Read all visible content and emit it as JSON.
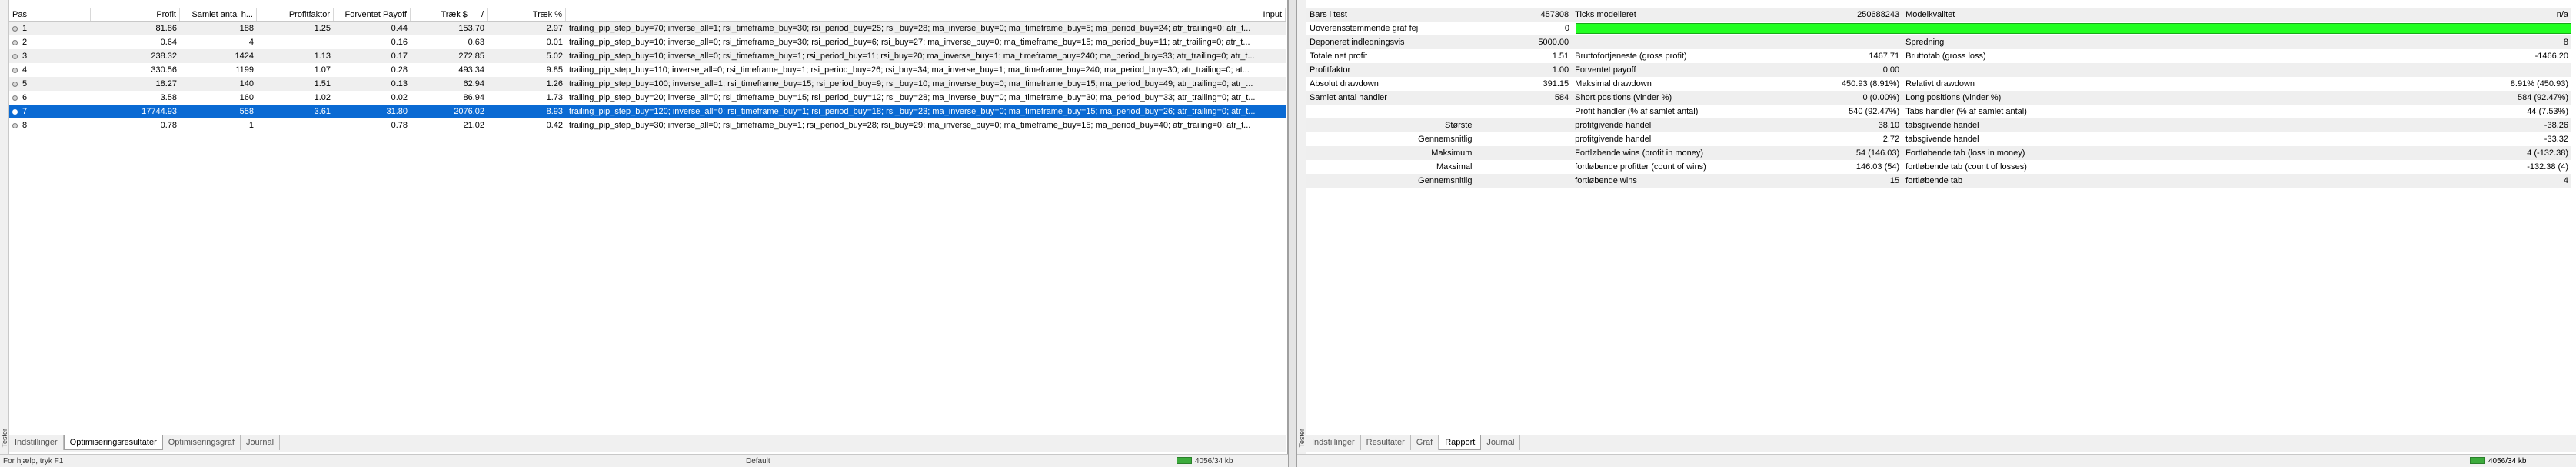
{
  "left": {
    "vertical_tab": "Tester",
    "columns": [
      "Pas",
      "Profit",
      "Samlet antal h...",
      "Profitfaktor",
      "Forventet Payoff",
      "Træk $",
      "/",
      "Træk %",
      "Input"
    ],
    "rows": [
      {
        "pas": "1",
        "profit": "81.86",
        "trades": "188",
        "pf": "1.25",
        "payoff": "0.44",
        "dd": "153.70",
        "ddp": "2.97",
        "input": "trailing_pip_step_buy=70; inverse_all=1; rsi_timeframe_buy=30; rsi_period_buy=25; rsi_buy=28; ma_inverse_buy=0; ma_timeframe_buy=5; ma_period_buy=24; atr_trailing=0; atr_t..."
      },
      {
        "pas": "2",
        "profit": "0.64",
        "trades": "4",
        "pf": "",
        "payoff": "0.16",
        "dd": "0.63",
        "ddp": "0.01",
        "input": "trailing_pip_step_buy=10; inverse_all=0; rsi_timeframe_buy=30; rsi_period_buy=6; rsi_buy=27; ma_inverse_buy=0; ma_timeframe_buy=15; ma_period_buy=11; atr_trailing=0; atr_t..."
      },
      {
        "pas": "3",
        "profit": "238.32",
        "trades": "1424",
        "pf": "1.13",
        "payoff": "0.17",
        "dd": "272.85",
        "ddp": "5.02",
        "input": "trailing_pip_step_buy=10; inverse_all=0; rsi_timeframe_buy=1; rsi_period_buy=11; rsi_buy=20; ma_inverse_buy=1; ma_timeframe_buy=240; ma_period_buy=33; atr_trailing=0; atr_t..."
      },
      {
        "pas": "4",
        "profit": "330.56",
        "trades": "1199",
        "pf": "1.07",
        "payoff": "0.28",
        "dd": "493.34",
        "ddp": "9.85",
        "input": "trailing_pip_step_buy=110; inverse_all=0; rsi_timeframe_buy=1; rsi_period_buy=26; rsi_buy=34; ma_inverse_buy=1; ma_timeframe_buy=240; ma_period_buy=30; atr_trailing=0; at..."
      },
      {
        "pas": "5",
        "profit": "18.27",
        "trades": "140",
        "pf": "1.51",
        "payoff": "0.13",
        "dd": "62.94",
        "ddp": "1.26",
        "input": "trailing_pip_step_buy=100; inverse_all=1; rsi_timeframe_buy=15; rsi_period_buy=9; rsi_buy=10; ma_inverse_buy=0; ma_timeframe_buy=15; ma_period_buy=49; atr_trailing=0; atr_..."
      },
      {
        "pas": "6",
        "profit": "3.58",
        "trades": "160",
        "pf": "1.02",
        "payoff": "0.02",
        "dd": "86.94",
        "ddp": "1.73",
        "input": "trailing_pip_step_buy=20; inverse_all=0; rsi_timeframe_buy=15; rsi_period_buy=12; rsi_buy=28; ma_inverse_buy=0; ma_timeframe_buy=30; ma_period_buy=33; atr_trailing=0; atr_t..."
      },
      {
        "pas": "7",
        "profit": "17744.93",
        "trades": "558",
        "pf": "3.61",
        "payoff": "31.80",
        "dd": "2076.02",
        "ddp": "8.93",
        "input": "trailing_pip_step_buy=120; inverse_all=0; rsi_timeframe_buy=1; rsi_period_buy=18; rsi_buy=23; ma_inverse_buy=0; ma_timeframe_buy=15; ma_period_buy=26; atr_trailing=0; atr_t..."
      },
      {
        "pas": "8",
        "profit": "0.78",
        "trades": "1",
        "pf": "",
        "payoff": "0.78",
        "dd": "21.02",
        "ddp": "0.42",
        "input": "trailing_pip_step_buy=30; inverse_all=0; rsi_timeframe_buy=1; rsi_period_buy=28; rsi_buy=29; ma_inverse_buy=0; ma_timeframe_buy=15; ma_period_buy=40; atr_trailing=0; atr_t..."
      }
    ],
    "selected_row": "7",
    "tabs": [
      "Indstillinger",
      "Optimiseringsresultater",
      "Optimiseringsgraf",
      "Journal"
    ],
    "active_tab": "Optimiseringsresultater",
    "status": {
      "text": "For hjælp, tryk F1",
      "profile": "Default",
      "connection": "4056/34 kb"
    }
  },
  "right": {
    "vertical_tab": "Tester",
    "report": [
      {
        "l1": "Bars i test",
        "v1": "457308",
        "l2": "Ticks modelleret",
        "v2": "250688243",
        "l3": "Modelkvalitet",
        "v3": "n/a"
      },
      {
        "l1": "Uoverensstemmende graf fejl",
        "v1": "0",
        "graph": true
      },
      {
        "l1": "Deponeret indledningsvis",
        "v1": "5000.00",
        "l2": "",
        "v2": "",
        "l3": "Spredning",
        "v3": "8"
      },
      {
        "l1": "Totale net profit",
        "v1": "1.51",
        "l2": "Bruttofortjeneste (gross profit)",
        "v2": "1467.71",
        "l3": "Bruttotab (gross loss)",
        "v3": "-1466.20"
      },
      {
        "l1": "Profitfaktor",
        "v1": "1.00",
        "l2": "Forventet payoff",
        "v2": "0.00",
        "l3": "",
        "v3": ""
      },
      {
        "l1": "Absolut drawdown",
        "v1": "391.15",
        "l2": "Maksimal drawdown",
        "v2": "450.93 (8.91%)",
        "l3": "Relativt drawdown",
        "v3": "8.91% (450.93)"
      },
      {
        "l1": "Samlet antal handler",
        "v1": "584",
        "l2": "Short positions (vinder %)",
        "v2": "0 (0.00%)",
        "l3": "Long positions (vinder %)",
        "v3": "584 (92.47%)"
      },
      {
        "l1": "",
        "v1": "",
        "l2": "Profit handler (% af samlet antal)",
        "v2": "540 (92.47%)",
        "l3": "Tabs handler (% af samlet antal)",
        "v3": "44 (7.53%)"
      },
      {
        "l1": "Største",
        "v1": "",
        "l2": "profitgivende handel",
        "v2": "38.10",
        "l3": "tabsgivende handel",
        "v3": "-38.26",
        "right": true
      },
      {
        "l1": "Gennemsnitlig",
        "v1": "",
        "l2": "profitgivende handel",
        "v2": "2.72",
        "l3": "tabsgivende handel",
        "v3": "-33.32",
        "right": true
      },
      {
        "l1": "Maksimum",
        "v1": "",
        "l2": "Fortløbende wins (profit in money)",
        "v2": "54 (146.03)",
        "l3": "Fortløbende tab (loss in money)",
        "v3": "4 (-132.38)",
        "right": true
      },
      {
        "l1": "Maksimal",
        "v1": "",
        "l2": "fortløbende profitter (count of wins)",
        "v2": "146.03 (54)",
        "l3": "fortløbende tab (count of losses)",
        "v3": "-132.38 (4)",
        "right": true
      },
      {
        "l1": "Gennemsnitlig",
        "v1": "",
        "l2": "fortløbende wins",
        "v2": "15",
        "l3": "fortløbende tab",
        "v3": "4",
        "right": true
      }
    ],
    "tabs": [
      "Indstillinger",
      "Resultater",
      "Graf",
      "Rapport",
      "Journal"
    ],
    "active_tab": "Rapport",
    "status": {
      "connection": "4056/34 kb"
    }
  },
  "colors": {
    "selection": "#0a6ad3",
    "graph_bar": "#22ff22",
    "alt_row": "#efefef"
  }
}
